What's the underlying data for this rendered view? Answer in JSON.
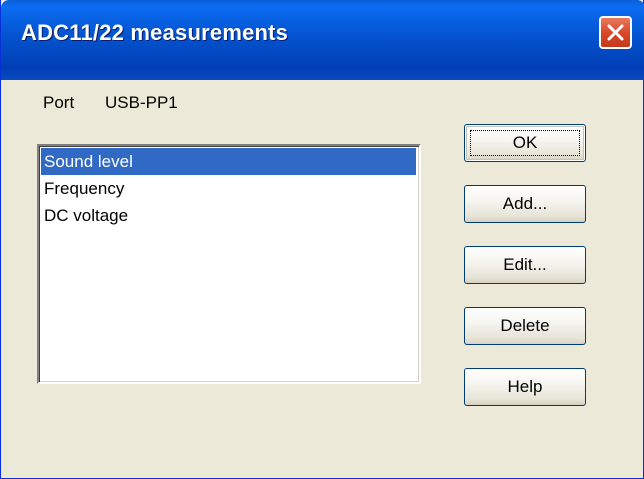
{
  "window": {
    "title": "ADC11/22 measurements",
    "close_icon": "close-icon"
  },
  "port": {
    "label": "Port",
    "value": "USB-PP1"
  },
  "measurements": {
    "items": [
      {
        "label": "Sound level",
        "selected": true
      },
      {
        "label": "Frequency",
        "selected": false
      },
      {
        "label": "DC voltage",
        "selected": false
      }
    ]
  },
  "buttons": {
    "ok": "OK",
    "add": "Add...",
    "edit": "Edit...",
    "delete": "Delete",
    "help": "Help"
  },
  "colors": {
    "titlebar": "#0453cf",
    "selection": "#316ac5",
    "dialog_bg": "#ece9d8",
    "close_button": "#d6462a"
  }
}
